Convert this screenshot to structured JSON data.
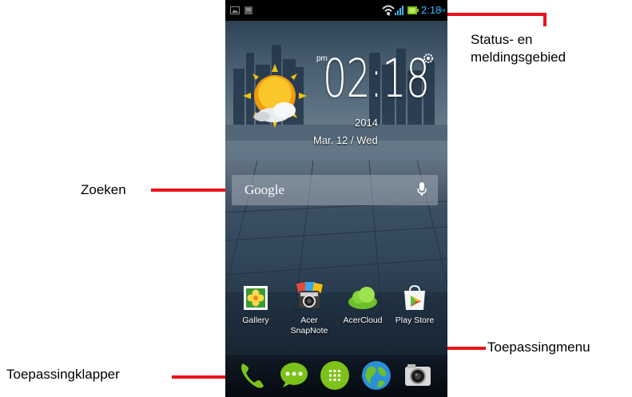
{
  "callouts": {
    "status_line1": "Status- en",
    "status_line2": "meldingsgebied",
    "search": "Zoeken",
    "app_menu": "Toepassingmenu",
    "app_launcher": "Toepassingklapper"
  },
  "status_bar": {
    "time": "2:18",
    "time_suffix": "PM",
    "icons": [
      "image-icon",
      "notification-icon",
      "wifi-icon",
      "signal-icon",
      "battery-icon"
    ]
  },
  "clock_widget": {
    "pm": "pm",
    "time": "02:18",
    "year": "2014",
    "date": "Mar. 12 / Wed",
    "weather_icon": "sun-cloud-icon",
    "settings_icon": "gear-icon"
  },
  "search_bar": {
    "brand": "Google",
    "icon": "mic-icon"
  },
  "apps": [
    {
      "label": "Gallery",
      "icon": "gallery-icon"
    },
    {
      "label": "Acer\nSnapNote",
      "icon": "snapnote-icon"
    },
    {
      "label": "AcerCloud",
      "icon": "cloud-icon"
    },
    {
      "label": "Play Store",
      "icon": "play-store-icon"
    }
  ],
  "dock": [
    "phone-icon",
    "messaging-icon",
    "app-menu-icon",
    "browser-icon",
    "camera-icon"
  ],
  "colors": {
    "callout_red": "#e8141b",
    "status_time": "#3ab6ff",
    "dock_green": "#7cc21a"
  }
}
